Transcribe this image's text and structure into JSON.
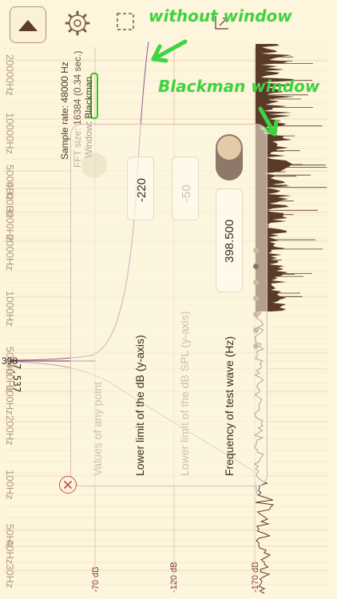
{
  "toolbar": {
    "play_icon": "triangle-up-icon",
    "settings_icon": "gear-icon",
    "select_icon": "dashed-square-icon",
    "move_icon": "crop-arrow-icon"
  },
  "annotations": {
    "without_window": "without window",
    "blackman_window": "Blackman window"
  },
  "info": {
    "sample_rate": "Sample rate: 48000 Hz",
    "fft_size": "FFT size: 16384 (0.34 sec.)",
    "window": "Window: Blackman"
  },
  "frequency_labels": [
    "20000Hz",
    "10000Hz",
    "5000Hz",
    "4000Hz",
    "3000Hz",
    "2000Hz",
    "1000Hz",
    "500Hz",
    "400Hz",
    "300Hz",
    "200Hz",
    "100Hz",
    "50Hz",
    "40Hz",
    "30Hz"
  ],
  "db_labels": [
    "-70 dB",
    "-120 dB",
    "-170 dB"
  ],
  "readout": {
    "frequency": "398",
    "level": "-7.537"
  },
  "panel": {
    "values_of_any_point": "Values of any point",
    "lower_limit_db_label": "Lower limit of the dB (y-axis)",
    "lower_limit_db_value": "-220",
    "lower_limit_spl_label": "Lower limit of the dB SPL (y-axis)",
    "lower_limit_spl_value": "-50",
    "test_wave_label": "Frequency of test wave (Hz)",
    "test_wave_value": "398.500",
    "close_icon": "close-x-icon",
    "page_count": 7,
    "active_page": 2
  },
  "colors": {
    "background": "#fdf5dc",
    "spectrum": "#5a3a28",
    "trace": "#8e5aa0",
    "green_note": "#3fd33f",
    "close": "#c9505a"
  }
}
